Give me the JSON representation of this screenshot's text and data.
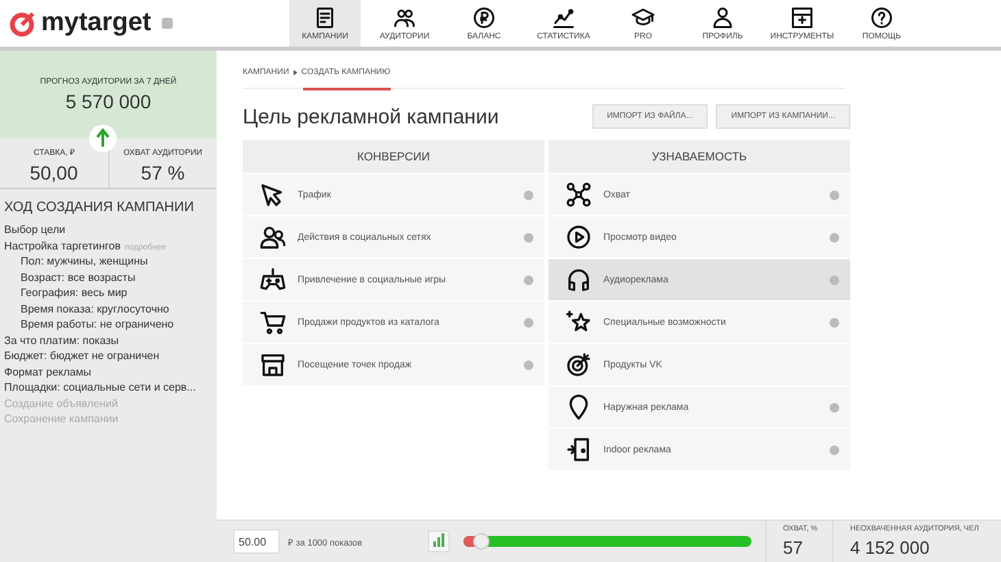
{
  "header": {
    "logo": "mytarget",
    "nav": [
      {
        "label": "КАМПАНИИ",
        "selected": true
      },
      {
        "label": "АУДИТОРИИ",
        "selected": false
      },
      {
        "label": "БАЛАНС",
        "selected": false
      },
      {
        "label": "СТАТИСТИКА",
        "selected": false
      },
      {
        "label": "PRO",
        "selected": false
      },
      {
        "label": "ПРОФИЛЬ",
        "selected": false
      },
      {
        "label": "ИНСТРУМЕНТЫ",
        "selected": false
      },
      {
        "label": "ПОМОЩЬ",
        "selected": false
      }
    ]
  },
  "sidebar": {
    "forecast": {
      "label": "ПРОГНОЗ АУДИТОРИИ ЗА 7 ДНЕЙ",
      "value": "5 570 000"
    },
    "stats": [
      {
        "label": "СТАВКА, ₽",
        "value": "50,00"
      },
      {
        "label": "ОХВАТ АУДИТОРИИ",
        "value": "57 %"
      }
    ],
    "progress_title": "ХОД СОЗДАНИЯ КАМПАНИИ",
    "steps": [
      {
        "text": "Выбор цели",
        "disabled": false
      },
      {
        "text": "Настройка таргетингов",
        "link": "подробнее",
        "disabled": false,
        "children": [
          {
            "text": "Пол: мужчины, женщины",
            "disabled": false
          },
          {
            "text": "Возраст: все возрасты",
            "disabled": false
          },
          {
            "text": "География: весь мир",
            "disabled": false
          },
          {
            "text": "Время показа: круглосуточно",
            "disabled": false
          },
          {
            "text": "Время работы: не ограничено",
            "disabled": false
          }
        ]
      },
      {
        "text": "За что платим: показы",
        "disabled": false
      },
      {
        "text": "Бюджет: бюджет не ограничен",
        "disabled": false
      },
      {
        "text": "Формат рекламы",
        "disabled": false
      },
      {
        "text": "Площадки: социальные сети и серв...",
        "disabled": false
      },
      {
        "text": "Создание объявлений",
        "disabled": true
      },
      {
        "text": "Сохранение кампании",
        "disabled": true
      }
    ]
  },
  "breadcrumb": [
    "КАМПАНИИ",
    "СОЗДАТЬ КАМПАНИЮ"
  ],
  "title": "Цель рекламной кампании",
  "buttons": [
    "ИМПОРТ ИЗ ФАЙЛА...",
    "ИМПОРТ ИЗ КАМПАНИИ..."
  ],
  "goal_columns": [
    {
      "title": "КОНВЕРСИИ",
      "items": [
        {
          "label": "Трафик",
          "help": true,
          "selected": false
        },
        {
          "label": "Действия в социальных сетях",
          "help": true,
          "selected": false
        },
        {
          "label": "Привлечение в социальные игры",
          "help": true,
          "selected": false
        },
        {
          "label": "Продажи продуктов из каталога",
          "help": true,
          "selected": false
        },
        {
          "label": "Посещение точек продаж",
          "help": true,
          "selected": false
        }
      ]
    },
    {
      "title": "УЗНАВАЕМОСТЬ",
      "items": [
        {
          "label": "Охват",
          "help": true,
          "selected": false
        },
        {
          "label": "Просмотр видео",
          "help": true,
          "selected": false
        },
        {
          "label": "Аудиореклама",
          "help": true,
          "selected": true
        },
        {
          "label": "Специальные возможности",
          "help": true,
          "selected": false
        },
        {
          "label": "Продукты VK",
          "help": false,
          "selected": false
        },
        {
          "label": "Наружная реклама",
          "help": true,
          "selected": false
        },
        {
          "label": "Indoor реклама",
          "help": true,
          "selected": false
        }
      ]
    }
  ],
  "footer": {
    "bid": "50.00",
    "bid_unit": "₽ за 1000 показов",
    "slider": {
      "level": 0.06
    },
    "reach": {
      "label": "ОХВАТ, %",
      "value": "57"
    },
    "unreached": {
      "label": "НЕОХВАЧЕННАЯ АУДИТОРИЯ, ЧЕЛ",
      "value": "4 152 000"
    }
  }
}
